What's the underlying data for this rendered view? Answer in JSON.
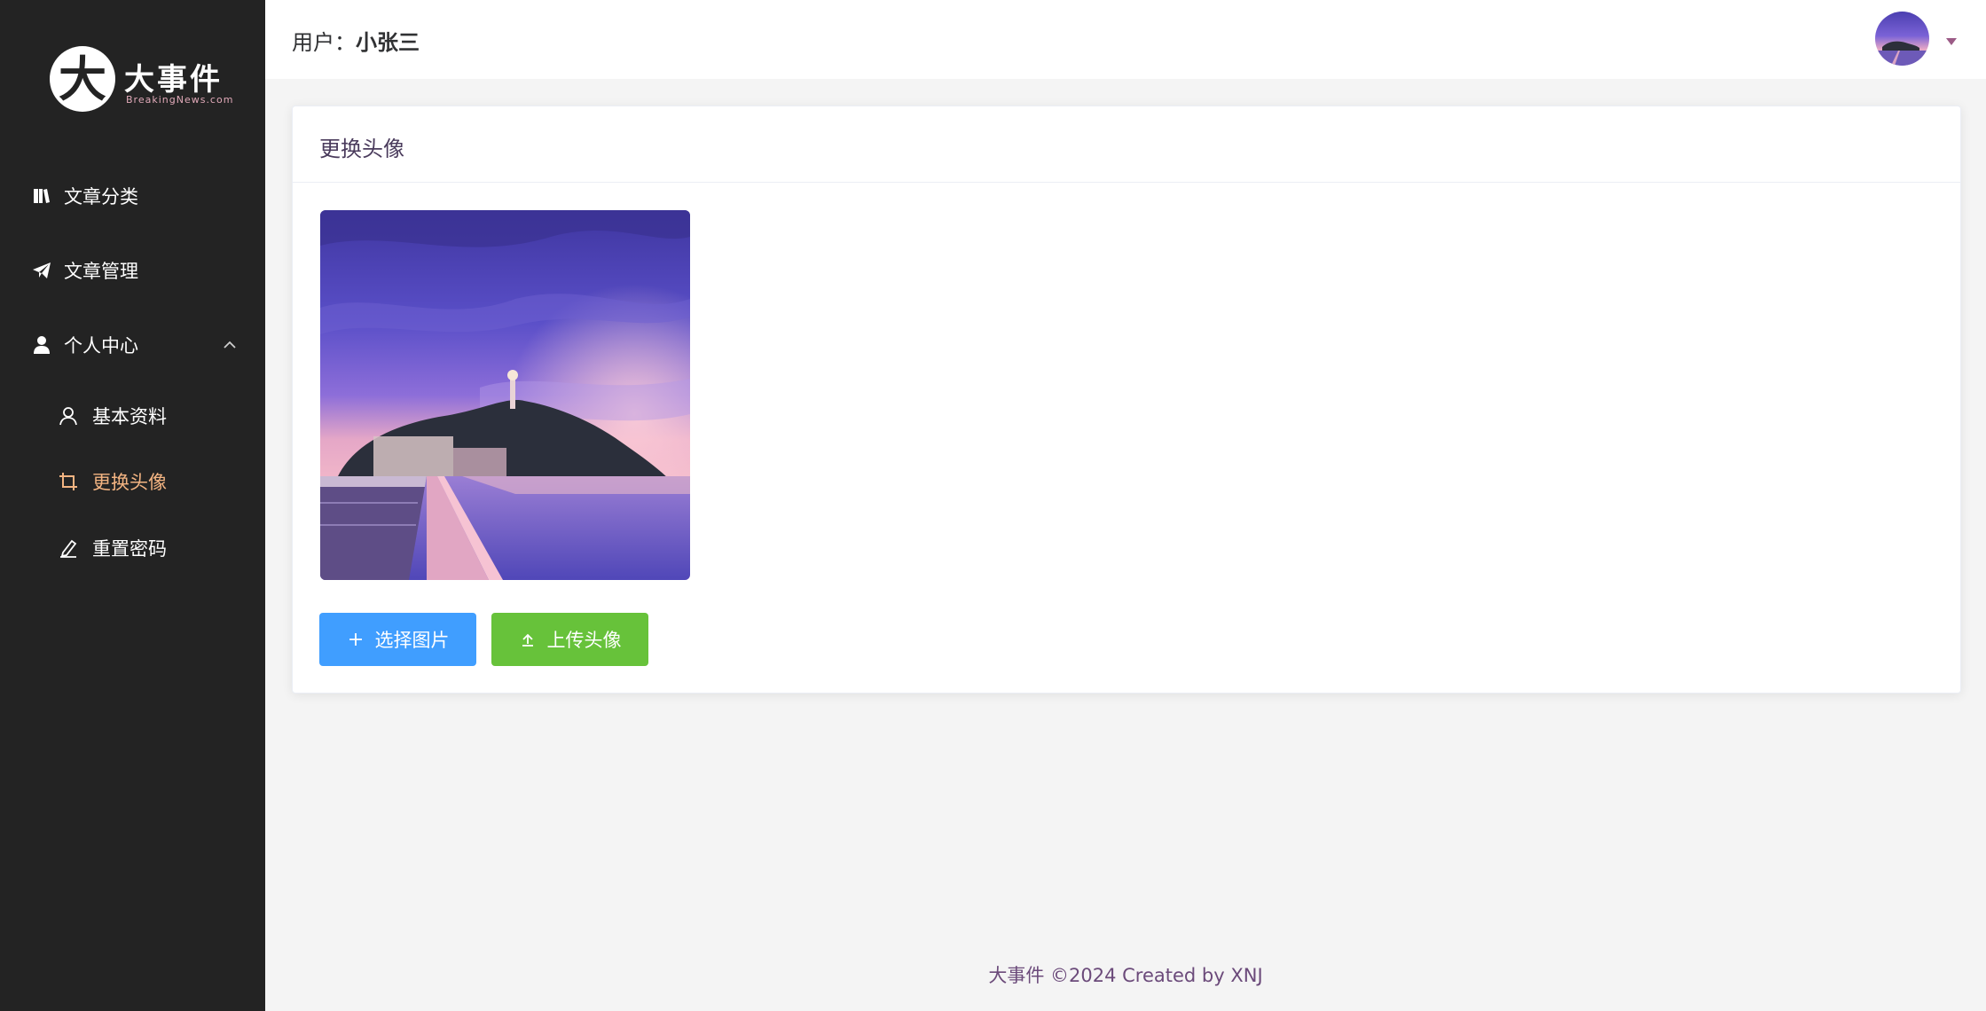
{
  "logo": {
    "glyph": "大",
    "title": "大事件",
    "subtitle": "BreakingNews.com"
  },
  "sidebar": {
    "items": [
      {
        "label": "文章分类",
        "icon": "book-icon"
      },
      {
        "label": "文章管理",
        "icon": "paper-plane-icon"
      },
      {
        "label": "个人中心",
        "icon": "user-icon",
        "expanded": true
      },
      {
        "label": "基本资料",
        "icon": "user-outline-icon"
      },
      {
        "label": "更换头像",
        "icon": "crop-icon",
        "active": true
      },
      {
        "label": "重置密码",
        "icon": "edit-pen-icon"
      }
    ]
  },
  "header": {
    "user_prefix": "用户：",
    "user_name": "小张三"
  },
  "card": {
    "title": "更换头像",
    "select_button": "选择图片",
    "upload_button": "上传头像"
  },
  "footer": {
    "text": "大事件 ©2024 Created by XNJ"
  },
  "colors": {
    "sidebar_bg": "#232323",
    "active_menu": "#f3b482",
    "primary": "#409eff",
    "success": "#67c23a"
  }
}
